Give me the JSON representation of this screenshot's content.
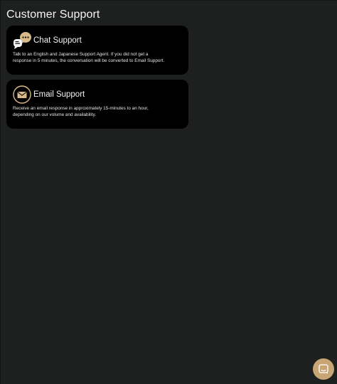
{
  "page": {
    "title": "Customer Support"
  },
  "chat_card": {
    "title": "Chat Support",
    "description_line1": "Talk to an English and Japanese Support Agent. If you did not get a",
    "description_line2": "response in 5 minutes, the conversation will be converted to Email Support.",
    "icon": "chat-bubbles-icon"
  },
  "email_card": {
    "title": "Email Support",
    "description_line1": "Receive an email response in approximately 15-minutes to an hour,",
    "description_line2": "depending on our volume and availability.",
    "icon": "envelope-icon"
  },
  "launcher": {
    "icon": "chat-launcher-icon"
  },
  "colors": {
    "background": "#1e1f1f",
    "card": "#000000",
    "accent": "#c8a574",
    "text": "#ffffff"
  }
}
